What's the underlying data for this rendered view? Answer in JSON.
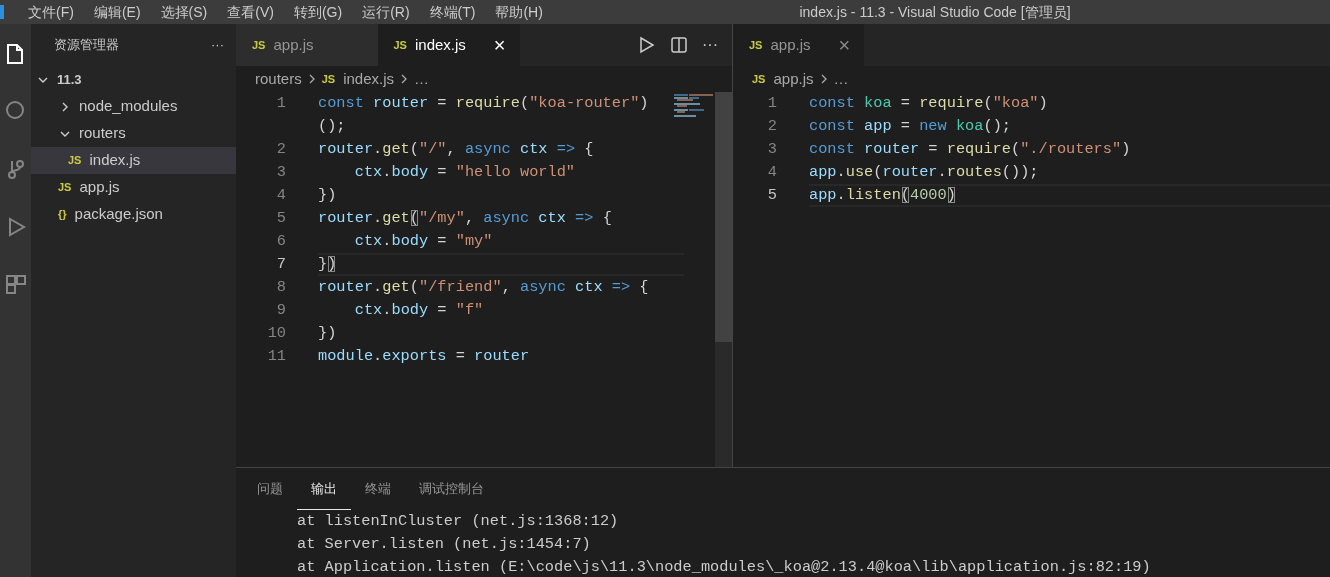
{
  "window": {
    "title": "index.js - 11.3 - Visual Studio Code [管理员]"
  },
  "menu": [
    "文件(F)",
    "编辑(E)",
    "选择(S)",
    "查看(V)",
    "转到(G)",
    "运行(R)",
    "终端(T)",
    "帮助(H)"
  ],
  "activity_bar": [
    {
      "kind": "files",
      "selected": true
    },
    {
      "kind": "search",
      "selected": false
    },
    {
      "kind": "source-control",
      "selected": false
    },
    {
      "kind": "run",
      "selected": false
    },
    {
      "kind": "extensions",
      "selected": false
    }
  ],
  "explorer": {
    "title": "资源管理器",
    "more": "···",
    "tree": [
      {
        "label": "11.3",
        "kind": "root",
        "expanded": true,
        "selected": false,
        "children": [
          {
            "label": "node_modules",
            "kind": "folder",
            "expanded": false,
            "selected": false
          },
          {
            "label": "routers",
            "kind": "folder",
            "expanded": true,
            "selected": false,
            "children": [
              {
                "label": "index.js",
                "kind": "file",
                "icon": "JS",
                "selected": true
              }
            ]
          },
          {
            "label": "app.js",
            "kind": "file",
            "icon": "JS",
            "selected": false
          },
          {
            "label": "package.json",
            "kind": "file",
            "icon": "{}",
            "selected": false
          }
        ]
      }
    ]
  },
  "editors": [
    {
      "focused": true,
      "tabs": [
        {
          "label": "app.js",
          "icon": "JS",
          "selected": false
        },
        {
          "label": "index.js",
          "icon": "JS",
          "selected": true,
          "close": "×"
        }
      ],
      "actions": [
        {
          "kind": "run"
        },
        {
          "kind": "split"
        },
        {
          "kind": "more",
          "text": "···"
        }
      ],
      "breadcrumb": [
        {
          "text": "routers"
        },
        {
          "icon": "JS",
          "text": "index.js"
        },
        {
          "text": "…"
        }
      ],
      "lines": [
        {
          "number": "1",
          "current": false,
          "rows": [
            [
              {
                "kind": "keyword",
                "text": "const"
              },
              {
                "kind": "plain",
                "text": " "
              },
              {
                "kind": "variable",
                "text": "router"
              },
              {
                "kind": "plain",
                "text": " = "
              },
              {
                "kind": "function",
                "text": "require"
              },
              {
                "kind": "plain",
                "text": "("
              },
              {
                "kind": "string",
                "text": "\"koa-router\""
              },
              {
                "kind": "plain",
                "text": ")"
              }
            ],
            [
              {
                "kind": "plain",
                "text": "();"
              }
            ]
          ]
        },
        {
          "number": "2",
          "current": false,
          "rows": [
            [
              {
                "kind": "variable",
                "text": "router"
              },
              {
                "kind": "plain",
                "text": "."
              },
              {
                "kind": "function",
                "text": "get"
              },
              {
                "kind": "plain",
                "text": "("
              },
              {
                "kind": "string",
                "text": "\"/\""
              },
              {
                "kind": "plain",
                "text": ", "
              },
              {
                "kind": "keyword",
                "text": "async"
              },
              {
                "kind": "plain",
                "text": " "
              },
              {
                "kind": "variable",
                "text": "ctx"
              },
              {
                "kind": "plain",
                "text": " "
              },
              {
                "kind": "keyword",
                "text": "=>"
              },
              {
                "kind": "plain",
                "text": " {"
              }
            ]
          ]
        },
        {
          "number": "3",
          "current": false,
          "rows": [
            [
              {
                "kind": "plain",
                "text": "    "
              },
              {
                "kind": "variable",
                "text": "ctx"
              },
              {
                "kind": "plain",
                "text": "."
              },
              {
                "kind": "variable",
                "text": "body"
              },
              {
                "kind": "plain",
                "text": " = "
              },
              {
                "kind": "string",
                "text": "\"hello world\""
              }
            ]
          ]
        },
        {
          "number": "4",
          "current": false,
          "rows": [
            [
              {
                "kind": "plain",
                "text": "})"
              }
            ]
          ]
        },
        {
          "number": "5",
          "current": false,
          "rows": [
            [
              {
                "kind": "variable",
                "text": "router"
              },
              {
                "kind": "plain",
                "text": "."
              },
              {
                "kind": "function",
                "text": "get"
              },
              {
                "kind": "match",
                "text": "("
              },
              {
                "kind": "string",
                "text": "\"/my\""
              },
              {
                "kind": "plain",
                "text": ", "
              },
              {
                "kind": "keyword",
                "text": "async"
              },
              {
                "kind": "plain",
                "text": " "
              },
              {
                "kind": "variable",
                "text": "ctx"
              },
              {
                "kind": "plain",
                "text": " "
              },
              {
                "kind": "keyword",
                "text": "=>"
              },
              {
                "kind": "plain",
                "text": " {"
              }
            ]
          ]
        },
        {
          "number": "6",
          "current": false,
          "rows": [
            [
              {
                "kind": "plain",
                "text": "    "
              },
              {
                "kind": "variable",
                "text": "ctx"
              },
              {
                "kind": "plain",
                "text": "."
              },
              {
                "kind": "variable",
                "text": "body"
              },
              {
                "kind": "plain",
                "text": " = "
              },
              {
                "kind": "string",
                "text": "\"my\""
              }
            ]
          ]
        },
        {
          "number": "7",
          "current": true,
          "rows": [
            [
              {
                "kind": "plain",
                "text": "}"
              },
              {
                "kind": "match",
                "text": ")"
              }
            ]
          ]
        },
        {
          "number": "8",
          "current": false,
          "rows": [
            [
              {
                "kind": "variable",
                "text": "router"
              },
              {
                "kind": "plain",
                "text": "."
              },
              {
                "kind": "function",
                "text": "get"
              },
              {
                "kind": "plain",
                "text": "("
              },
              {
                "kind": "string",
                "text": "\"/friend\""
              },
              {
                "kind": "plain",
                "text": ", "
              },
              {
                "kind": "keyword",
                "text": "async"
              },
              {
                "kind": "plain",
                "text": " "
              },
              {
                "kind": "variable",
                "text": "ctx"
              },
              {
                "kind": "plain",
                "text": " "
              },
              {
                "kind": "keyword",
                "text": "=>"
              },
              {
                "kind": "plain",
                "text": " {"
              }
            ]
          ]
        },
        {
          "number": "9",
          "current": false,
          "rows": [
            [
              {
                "kind": "plain",
                "text": "    "
              },
              {
                "kind": "variable",
                "text": "ctx"
              },
              {
                "kind": "plain",
                "text": "."
              },
              {
                "kind": "variable",
                "text": "body"
              },
              {
                "kind": "plain",
                "text": " = "
              },
              {
                "kind": "string",
                "text": "\"f\""
              }
            ]
          ]
        },
        {
          "number": "10",
          "current": false,
          "rows": [
            [
              {
                "kind": "plain",
                "text": "})"
              }
            ]
          ]
        },
        {
          "number": "11",
          "current": false,
          "rows": [
            [
              {
                "kind": "variable",
                "text": "module"
              },
              {
                "kind": "plain",
                "text": "."
              },
              {
                "kind": "variable",
                "text": "exports"
              },
              {
                "kind": "plain",
                "text": " = "
              },
              {
                "kind": "variable",
                "text": "router"
              }
            ]
          ]
        }
      ]
    },
    {
      "focused": false,
      "tabs": [
        {
          "label": "app.js",
          "icon": "JS",
          "selected": true,
          "close": "×"
        }
      ],
      "breadcrumb": [
        {
          "icon": "JS",
          "text": "app.js"
        },
        {
          "text": "…"
        }
      ],
      "lines": [
        {
          "number": "1",
          "current": false,
          "rows": [
            [
              {
                "kind": "keyword",
                "text": "const"
              },
              {
                "kind": "plain",
                "text": " "
              },
              {
                "kind": "class",
                "text": "koa"
              },
              {
                "kind": "plain",
                "text": " = "
              },
              {
                "kind": "function",
                "text": "require"
              },
              {
                "kind": "plain",
                "text": "("
              },
              {
                "kind": "string",
                "text": "\"koa\""
              },
              {
                "kind": "plain",
                "text": ")"
              }
            ]
          ]
        },
        {
          "number": "2",
          "current": false,
          "rows": [
            [
              {
                "kind": "keyword",
                "text": "const"
              },
              {
                "kind": "plain",
                "text": " "
              },
              {
                "kind": "variable",
                "text": "app"
              },
              {
                "kind": "plain",
                "text": " = "
              },
              {
                "kind": "keyword",
                "text": "new"
              },
              {
                "kind": "plain",
                "text": " "
              },
              {
                "kind": "class",
                "text": "koa"
              },
              {
                "kind": "plain",
                "text": "();"
              }
            ]
          ]
        },
        {
          "number": "3",
          "current": false,
          "rows": [
            [
              {
                "kind": "keyword",
                "text": "const"
              },
              {
                "kind": "plain",
                "text": " "
              },
              {
                "kind": "variable",
                "text": "router"
              },
              {
                "kind": "plain",
                "text": " = "
              },
              {
                "kind": "function",
                "text": "require"
              },
              {
                "kind": "plain",
                "text": "("
              },
              {
                "kind": "string",
                "text": "\"./routers\""
              },
              {
                "kind": "plain",
                "text": ")"
              }
            ]
          ]
        },
        {
          "number": "4",
          "current": false,
          "rows": [
            [
              {
                "kind": "variable",
                "text": "app"
              },
              {
                "kind": "plain",
                "text": "."
              },
              {
                "kind": "function",
                "text": "use"
              },
              {
                "kind": "plain",
                "text": "("
              },
              {
                "kind": "variable",
                "text": "router"
              },
              {
                "kind": "plain",
                "text": "."
              },
              {
                "kind": "function",
                "text": "routes"
              },
              {
                "kind": "plain",
                "text": "());"
              }
            ]
          ]
        },
        {
          "number": "5",
          "current": true,
          "rows": [
            [
              {
                "kind": "variable",
                "text": "app"
              },
              {
                "kind": "plain",
                "text": "."
              },
              {
                "kind": "function",
                "text": "listen"
              },
              {
                "kind": "match",
                "text": "("
              },
              {
                "kind": "number",
                "text": "4000"
              },
              {
                "kind": "match",
                "text": ")"
              }
            ]
          ]
        }
      ]
    }
  ],
  "panel": {
    "tabs": [
      {
        "label": "问题",
        "selected": false
      },
      {
        "label": "输出",
        "selected": true
      },
      {
        "label": "终端",
        "selected": false
      },
      {
        "label": "调试控制台",
        "selected": false
      }
    ],
    "output": [
      "at listenInCluster (net.js:1368:12)",
      "at Server.listen (net.js:1454:7)",
      "at Application.listen (E:\\code\\js\\11.3\\node_modules\\_koa@2.13.4@koa\\lib\\application.js:82:19)"
    ]
  }
}
